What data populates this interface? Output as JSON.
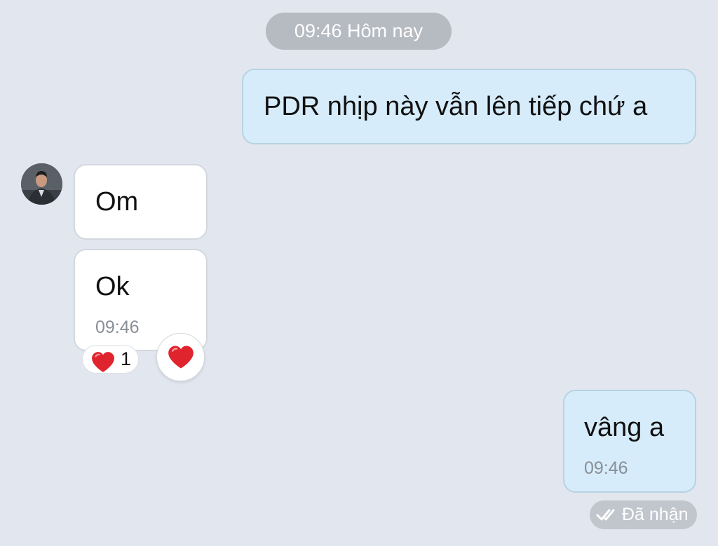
{
  "date_separator": {
    "time": "09:46",
    "day": "Hôm nay"
  },
  "messages": [
    {
      "direction": "outgoing",
      "text": "PDR nhịp này vẫn lên tiếp chứ a"
    },
    {
      "direction": "incoming",
      "text": "Om"
    },
    {
      "direction": "incoming",
      "text": "Ok",
      "time": "09:46"
    },
    {
      "direction": "outgoing",
      "text": "vâng a",
      "time": "09:46"
    }
  ],
  "reaction": {
    "emoji": "heart",
    "count": "1"
  },
  "status": {
    "icon": "double-check-icon",
    "text": "Đã nhận"
  },
  "colors": {
    "background": "#e2e6ee",
    "outgoing_bubble": "#d6ecfb",
    "incoming_bubble": "#ffffff",
    "pill": "#b6bac1",
    "heart": "#e0242e"
  }
}
